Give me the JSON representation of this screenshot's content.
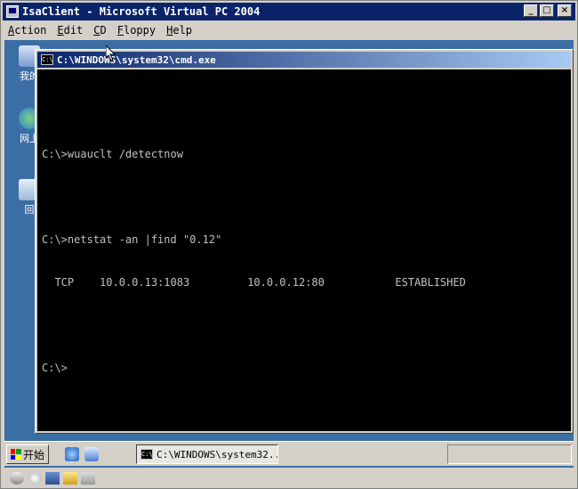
{
  "vpc": {
    "title": "IsaClient - Microsoft Virtual PC 2004",
    "menu": [
      {
        "label": "Action",
        "mnemonic": "A",
        "rest": "ction"
      },
      {
        "label": "Edit",
        "mnemonic": "E",
        "rest": "dit"
      },
      {
        "label": "CD",
        "mnemonic": "C",
        "rest": "D"
      },
      {
        "label": "Floppy",
        "mnemonic": "F",
        "rest": "loppy"
      },
      {
        "label": "Help",
        "mnemonic": "H",
        "rest": "elp"
      }
    ],
    "buttons": {
      "minimize": "_",
      "maximize": "□",
      "close": "×"
    }
  },
  "desktop": {
    "icons": [
      {
        "name": "my-computer",
        "label": "我的"
      },
      {
        "name": "network",
        "label": "网上"
      },
      {
        "name": "recycle-bin",
        "label": "回"
      }
    ]
  },
  "cmd": {
    "title": "C:\\WINDOWS\\system32\\cmd.exe",
    "icon_text": "C:\\",
    "lines": [
      "",
      "C:\\>wuauclt /detectnow",
      "",
      "C:\\>netstat -an |find \"0.12\"",
      "  TCP    10.0.0.13:1083         10.0.0.12:80           ESTABLISHED",
      "",
      "C:\\>"
    ]
  },
  "taskbar": {
    "start_label": "开始",
    "task_label": "C:\\WINDOWS\\system32..."
  },
  "colors": {
    "titlebar": "#0a246a",
    "desktop": "#3a6ea5",
    "console_bg": "#000000",
    "console_fg": "#c0c0c0"
  }
}
